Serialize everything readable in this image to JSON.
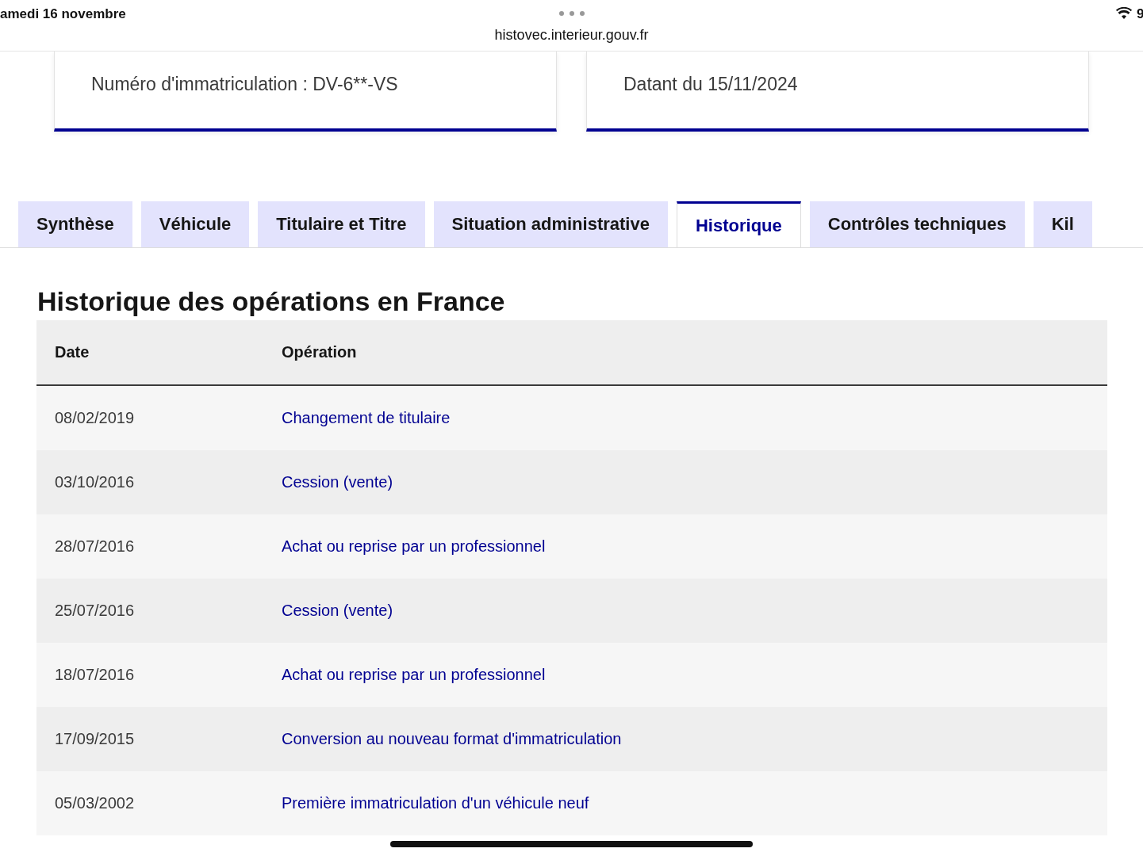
{
  "status_bar": {
    "date": "amedi 16 novembre",
    "url": "histovec.interieur.gouv.fr",
    "battery": "9"
  },
  "cards": [
    {
      "text": "Numéro d'immatriculation : DV-6**-VS"
    },
    {
      "text": "Datant du 15/11/2024"
    }
  ],
  "tabs": [
    {
      "label": "Synthèse",
      "selected": false
    },
    {
      "label": "Véhicule",
      "selected": false
    },
    {
      "label": "Titulaire et Titre",
      "selected": false
    },
    {
      "label": "Situation administrative",
      "selected": false
    },
    {
      "label": "Historique",
      "selected": true
    },
    {
      "label": "Contrôles techniques",
      "selected": false
    },
    {
      "label": "Kil",
      "selected": false
    }
  ],
  "section": {
    "title": "Historique des opérations en France",
    "table": {
      "columns": [
        "Date",
        "Opération"
      ],
      "rows": [
        {
          "date": "08/02/2019",
          "operation": "Changement de titulaire"
        },
        {
          "date": "03/10/2016",
          "operation": "Cession (vente)"
        },
        {
          "date": "28/07/2016",
          "operation": "Achat ou reprise par un professionnel"
        },
        {
          "date": "25/07/2016",
          "operation": "Cession (vente)"
        },
        {
          "date": "18/07/2016",
          "operation": "Achat ou reprise par un professionnel"
        },
        {
          "date": "17/09/2015",
          "operation": "Conversion au nouveau format d'immatriculation"
        },
        {
          "date": "05/03/2002",
          "operation": "Première immatriculation d'un véhicule neuf"
        }
      ]
    }
  }
}
